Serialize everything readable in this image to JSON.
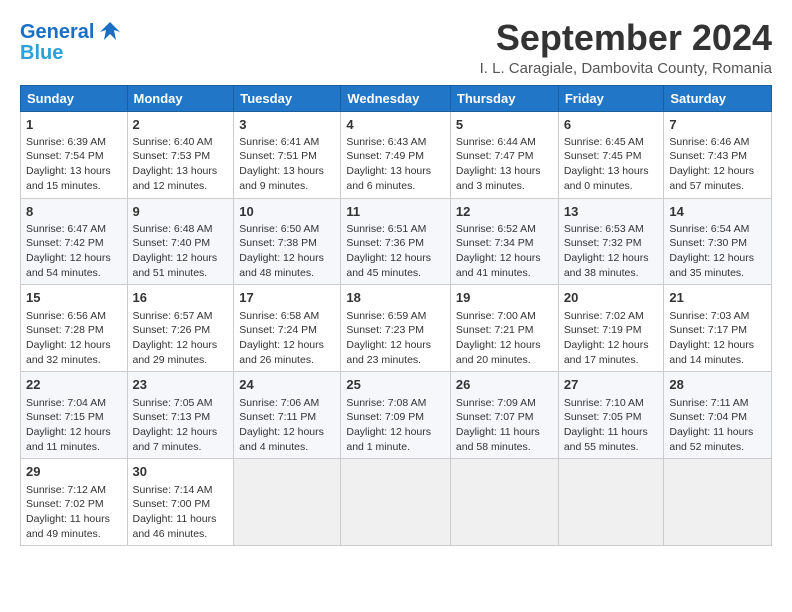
{
  "header": {
    "title": "September 2024",
    "location": "I. L. Caragiale, Dambovita County, Romania"
  },
  "columns": [
    "Sunday",
    "Monday",
    "Tuesday",
    "Wednesday",
    "Thursday",
    "Friday",
    "Saturday"
  ],
  "weeks": [
    [
      {
        "day": 1,
        "lines": [
          "Sunrise: 6:39 AM",
          "Sunset: 7:54 PM",
          "Daylight: 13 hours",
          "and 15 minutes."
        ]
      },
      {
        "day": 2,
        "lines": [
          "Sunrise: 6:40 AM",
          "Sunset: 7:53 PM",
          "Daylight: 13 hours",
          "and 12 minutes."
        ]
      },
      {
        "day": 3,
        "lines": [
          "Sunrise: 6:41 AM",
          "Sunset: 7:51 PM",
          "Daylight: 13 hours",
          "and 9 minutes."
        ]
      },
      {
        "day": 4,
        "lines": [
          "Sunrise: 6:43 AM",
          "Sunset: 7:49 PM",
          "Daylight: 13 hours",
          "and 6 minutes."
        ]
      },
      {
        "day": 5,
        "lines": [
          "Sunrise: 6:44 AM",
          "Sunset: 7:47 PM",
          "Daylight: 13 hours",
          "and 3 minutes."
        ]
      },
      {
        "day": 6,
        "lines": [
          "Sunrise: 6:45 AM",
          "Sunset: 7:45 PM",
          "Daylight: 13 hours",
          "and 0 minutes."
        ]
      },
      {
        "day": 7,
        "lines": [
          "Sunrise: 6:46 AM",
          "Sunset: 7:43 PM",
          "Daylight: 12 hours",
          "and 57 minutes."
        ]
      }
    ],
    [
      {
        "day": 8,
        "lines": [
          "Sunrise: 6:47 AM",
          "Sunset: 7:42 PM",
          "Daylight: 12 hours",
          "and 54 minutes."
        ]
      },
      {
        "day": 9,
        "lines": [
          "Sunrise: 6:48 AM",
          "Sunset: 7:40 PM",
          "Daylight: 12 hours",
          "and 51 minutes."
        ]
      },
      {
        "day": 10,
        "lines": [
          "Sunrise: 6:50 AM",
          "Sunset: 7:38 PM",
          "Daylight: 12 hours",
          "and 48 minutes."
        ]
      },
      {
        "day": 11,
        "lines": [
          "Sunrise: 6:51 AM",
          "Sunset: 7:36 PM",
          "Daylight: 12 hours",
          "and 45 minutes."
        ]
      },
      {
        "day": 12,
        "lines": [
          "Sunrise: 6:52 AM",
          "Sunset: 7:34 PM",
          "Daylight: 12 hours",
          "and 41 minutes."
        ]
      },
      {
        "day": 13,
        "lines": [
          "Sunrise: 6:53 AM",
          "Sunset: 7:32 PM",
          "Daylight: 12 hours",
          "and 38 minutes."
        ]
      },
      {
        "day": 14,
        "lines": [
          "Sunrise: 6:54 AM",
          "Sunset: 7:30 PM",
          "Daylight: 12 hours",
          "and 35 minutes."
        ]
      }
    ],
    [
      {
        "day": 15,
        "lines": [
          "Sunrise: 6:56 AM",
          "Sunset: 7:28 PM",
          "Daylight: 12 hours",
          "and 32 minutes."
        ]
      },
      {
        "day": 16,
        "lines": [
          "Sunrise: 6:57 AM",
          "Sunset: 7:26 PM",
          "Daylight: 12 hours",
          "and 29 minutes."
        ]
      },
      {
        "day": 17,
        "lines": [
          "Sunrise: 6:58 AM",
          "Sunset: 7:24 PM",
          "Daylight: 12 hours",
          "and 26 minutes."
        ]
      },
      {
        "day": 18,
        "lines": [
          "Sunrise: 6:59 AM",
          "Sunset: 7:23 PM",
          "Daylight: 12 hours",
          "and 23 minutes."
        ]
      },
      {
        "day": 19,
        "lines": [
          "Sunrise: 7:00 AM",
          "Sunset: 7:21 PM",
          "Daylight: 12 hours",
          "and 20 minutes."
        ]
      },
      {
        "day": 20,
        "lines": [
          "Sunrise: 7:02 AM",
          "Sunset: 7:19 PM",
          "Daylight: 12 hours",
          "and 17 minutes."
        ]
      },
      {
        "day": 21,
        "lines": [
          "Sunrise: 7:03 AM",
          "Sunset: 7:17 PM",
          "Daylight: 12 hours",
          "and 14 minutes."
        ]
      }
    ],
    [
      {
        "day": 22,
        "lines": [
          "Sunrise: 7:04 AM",
          "Sunset: 7:15 PM",
          "Daylight: 12 hours",
          "and 11 minutes."
        ]
      },
      {
        "day": 23,
        "lines": [
          "Sunrise: 7:05 AM",
          "Sunset: 7:13 PM",
          "Daylight: 12 hours",
          "and 7 minutes."
        ]
      },
      {
        "day": 24,
        "lines": [
          "Sunrise: 7:06 AM",
          "Sunset: 7:11 PM",
          "Daylight: 12 hours",
          "and 4 minutes."
        ]
      },
      {
        "day": 25,
        "lines": [
          "Sunrise: 7:08 AM",
          "Sunset: 7:09 PM",
          "Daylight: 12 hours",
          "and 1 minute."
        ]
      },
      {
        "day": 26,
        "lines": [
          "Sunrise: 7:09 AM",
          "Sunset: 7:07 PM",
          "Daylight: 11 hours",
          "and 58 minutes."
        ]
      },
      {
        "day": 27,
        "lines": [
          "Sunrise: 7:10 AM",
          "Sunset: 7:05 PM",
          "Daylight: 11 hours",
          "and 55 minutes."
        ]
      },
      {
        "day": 28,
        "lines": [
          "Sunrise: 7:11 AM",
          "Sunset: 7:04 PM",
          "Daylight: 11 hours",
          "and 52 minutes."
        ]
      }
    ],
    [
      {
        "day": 29,
        "lines": [
          "Sunrise: 7:12 AM",
          "Sunset: 7:02 PM",
          "Daylight: 11 hours",
          "and 49 minutes."
        ]
      },
      {
        "day": 30,
        "lines": [
          "Sunrise: 7:14 AM",
          "Sunset: 7:00 PM",
          "Daylight: 11 hours",
          "and 46 minutes."
        ]
      },
      {
        "day": null,
        "lines": []
      },
      {
        "day": null,
        "lines": []
      },
      {
        "day": null,
        "lines": []
      },
      {
        "day": null,
        "lines": []
      },
      {
        "day": null,
        "lines": []
      }
    ]
  ]
}
